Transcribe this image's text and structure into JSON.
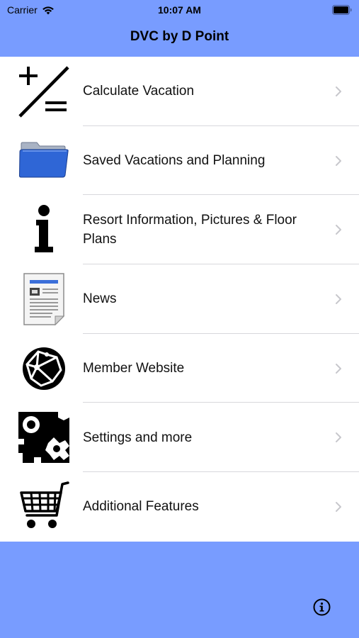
{
  "status_bar": {
    "carrier": "Carrier",
    "time": "10:07 AM"
  },
  "nav": {
    "title": "DVC by D Point"
  },
  "colors": {
    "bar_background": "#789cff",
    "separator": "#d8d8dc",
    "chevron": "#c7c7cc"
  },
  "menu": {
    "items": [
      {
        "label": "Calculate Vacation",
        "icon": "calculator-icon"
      },
      {
        "label": "Saved Vacations and Planning",
        "icon": "folder-icon"
      },
      {
        "label": "Resort Information, Pictures & Floor Plans",
        "icon": "info-icon"
      },
      {
        "label": "News",
        "icon": "newspaper-icon"
      },
      {
        "label": "Member Website",
        "icon": "globe-icon"
      },
      {
        "label": "Settings and more",
        "icon": "gears-icon"
      },
      {
        "label": "Additional Features",
        "icon": "shopping-cart-icon"
      }
    ]
  },
  "footer": {
    "info_button_icon": "info-circle-icon"
  }
}
